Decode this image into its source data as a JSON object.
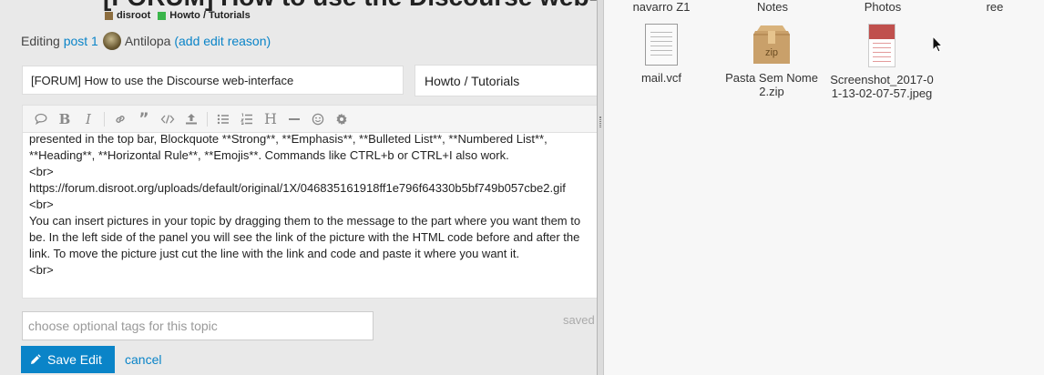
{
  "topic": {
    "title": "[FORUM] How to use the Discourse web-interface",
    "breadcrumb": [
      "disroot",
      "Howto / Tutorials"
    ]
  },
  "edit_header": {
    "editing": "Editing",
    "post_link": "post 1",
    "user": "Antilopa",
    "edit_reason": "(add edit reason)"
  },
  "composer": {
    "title_value": "[FORUM] How to use the Discourse web-interface",
    "category_value": "Howto / Tutorials",
    "toolbar_icons": [
      "quote-icon",
      "bold-icon",
      "italic-icon",
      "link-icon",
      "blockquote-icon",
      "code-icon",
      "upload-icon",
      "bullet-list-icon",
      "numbered-list-icon",
      "heading-icon",
      "horizontal-rule-icon",
      "emoji-icon",
      "gear-icon"
    ],
    "body_lines": [
      "presented in the top bar, Blockquote **Strong**, **Emphasis**, **Bulleted List**, **Numbered List**,",
      "**Heading**, **Horizontal Rule**, **Emojis**. Commands like CTRL+b or CTRL+I also work.",
      "<br>",
      "https://forum.disroot.org/uploads/default/original/1X/046835161918ff1e796f64330b5bf749b057cbe2.gif",
      "<br>",
      "You can insert pictures in your topic by dragging them to the message to the part where you want them to",
      "be. In the left side of the panel you will see the link of the picture with the HTML code before and after the",
      "link. To move the picture just cut the line with the link and code and paste it where you want it.",
      "<br>"
    ],
    "tags_placeholder": "choose optional tags for this topic",
    "saved_label": "saved",
    "save_button": "Save Edit",
    "cancel": "cancel"
  },
  "file_manager": {
    "top_labels": [
      "navarro Z1",
      "Notes",
      "Photos",
      "ree"
    ],
    "files": [
      {
        "name": "mail.vcf",
        "icon": "vcard-file-icon"
      },
      {
        "name": "Pasta Sem Nome 2.zip",
        "icon": "zip-archive-icon",
        "badge": "zip"
      },
      {
        "name": "Screenshot_2017-01-13-02-07-57.jpeg",
        "icon": "jpeg-image-icon"
      }
    ],
    "file_labels": [
      [
        "mail.vcf"
      ],
      [
        "Pasta Sem Nome",
        "2.zip"
      ],
      [
        "Screenshot_2017-0",
        "1-13-02-07-57.jpeg"
      ]
    ]
  },
  "colors": {
    "accent": "#0a84c8",
    "category_disroot": "#8c6d3f",
    "category_howto": "#3ab54a"
  }
}
